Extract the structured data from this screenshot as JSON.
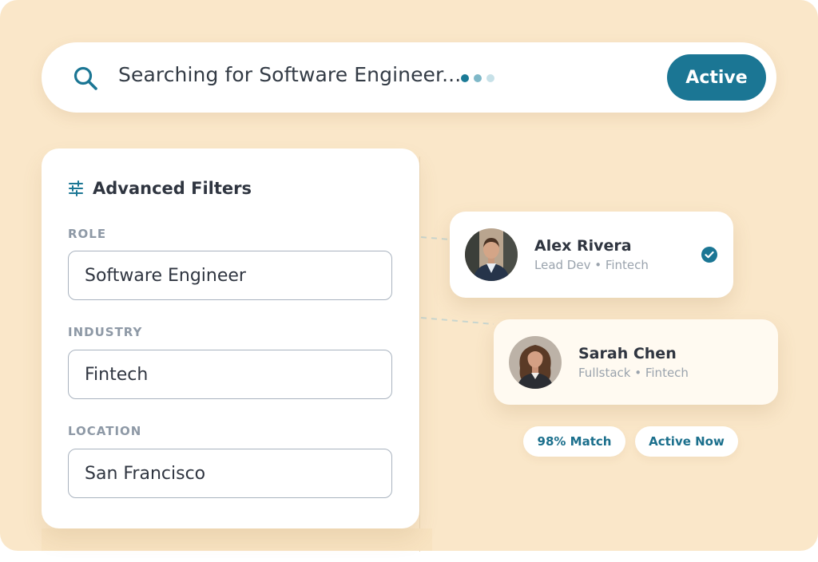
{
  "search": {
    "icon": "search-icon",
    "query_text": "Searching for Software Engineer...",
    "status_button": "Active"
  },
  "filters": {
    "icon": "sliders-icon",
    "title": "Advanced Filters",
    "fields": [
      {
        "label": "ROLE",
        "value": "Software Engineer"
      },
      {
        "label": "INDUSTRY",
        "value": "Fintech"
      },
      {
        "label": "LOCATION",
        "value": "San Francisco"
      }
    ]
  },
  "candidates": [
    {
      "name": "Alex Rivera",
      "role": "Lead Dev",
      "industry": "Fintech",
      "subtitle": "Lead Dev • Fintech",
      "verified": true,
      "verified_icon": "check-circle-icon"
    },
    {
      "name": "Sarah Chen",
      "role": "Fullstack",
      "industry": "Fintech",
      "subtitle": "Fullstack • Fintech",
      "verified": false
    }
  ],
  "badges": {
    "match": "98% Match",
    "status": "Active Now"
  },
  "colors": {
    "background": "#fae7c9",
    "accent": "#1b7694",
    "text_dark": "#2f3540",
    "text_muted": "#9aa3ad"
  }
}
